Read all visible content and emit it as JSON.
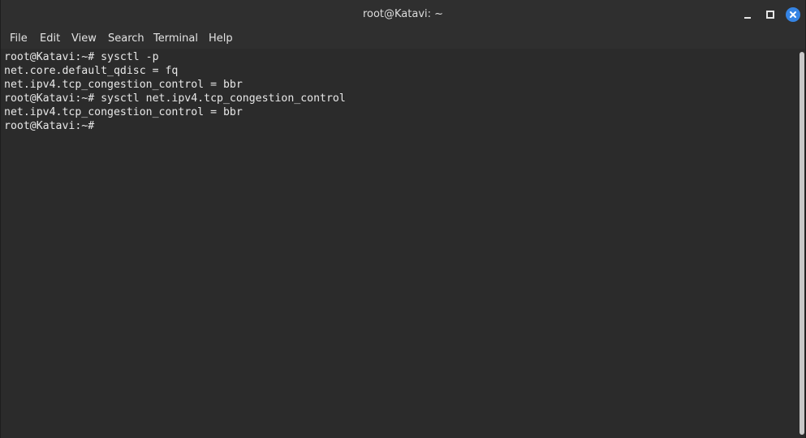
{
  "window": {
    "title": "root@Katavi: ~"
  },
  "menu": {
    "items": [
      {
        "label": "File"
      },
      {
        "label": "Edit"
      },
      {
        "label": "View"
      },
      {
        "label": "Search"
      },
      {
        "label": "Terminal"
      },
      {
        "label": "Help"
      }
    ]
  },
  "terminal": {
    "lines": [
      "root@Katavi:~# sysctl -p",
      "net.core.default_qdisc = fq",
      "net.ipv4.tcp_congestion_control = bbr",
      "root@Katavi:~# sysctl net.ipv4.tcp_congestion_control",
      "net.ipv4.tcp_congestion_control = bbr",
      "root@Katavi:~#"
    ]
  },
  "colors": {
    "accent": "#3584e4",
    "terminal_bg": "#2b2b2b",
    "terminal_fg": "#e8e8e8"
  }
}
